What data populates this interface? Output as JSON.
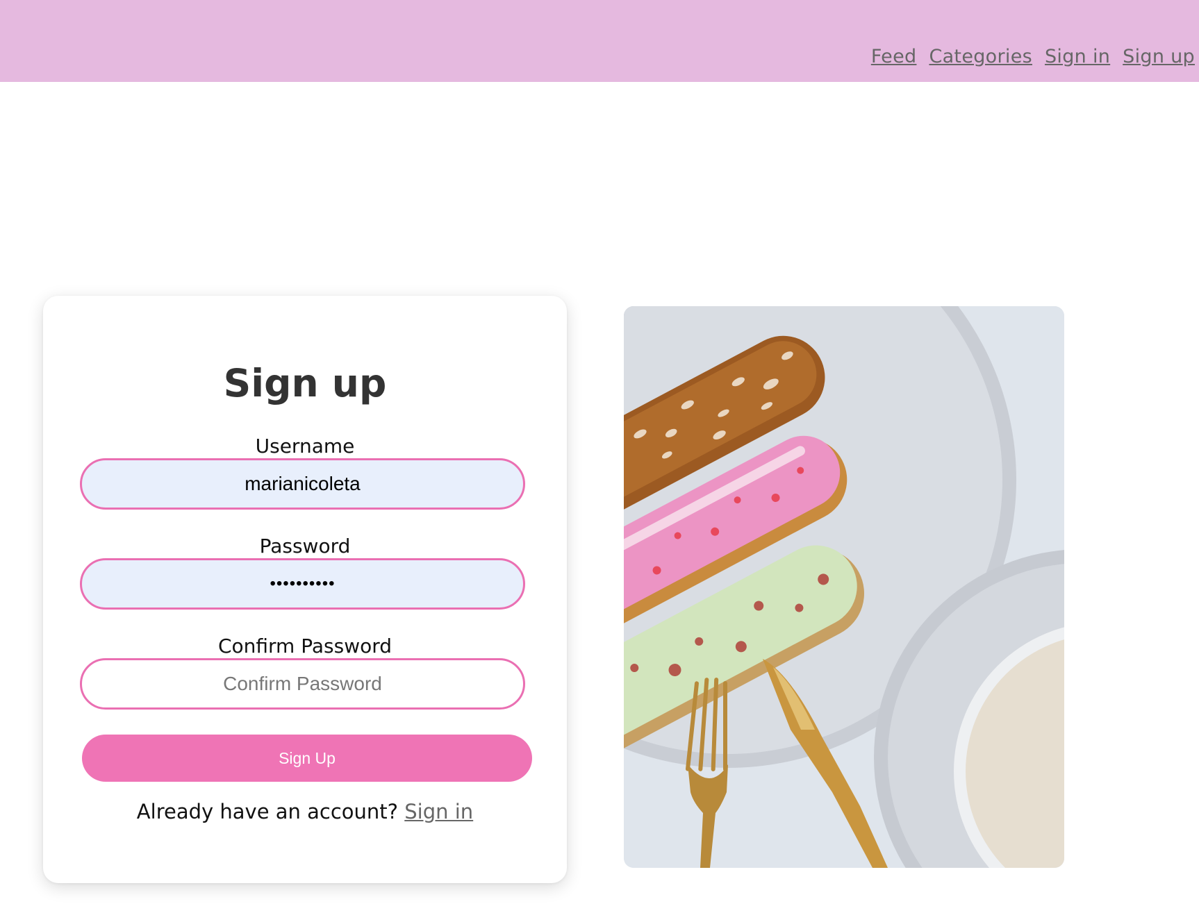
{
  "nav": {
    "links": [
      "Feed",
      "Categories",
      "Sign in",
      "Sign up"
    ]
  },
  "form": {
    "title": "Sign up",
    "username": {
      "label": "Username",
      "value": "marianicoleta"
    },
    "password": {
      "label": "Password",
      "value": "••••••••••"
    },
    "confirm": {
      "label": "Confirm Password",
      "value": "",
      "placeholder": "Confirm Password"
    },
    "submit_label": "Sign Up",
    "footer_text": "Already have an account?",
    "footer_link": "Sign in"
  },
  "colors": {
    "navbar_bg": "#e5b9df",
    "accent_pink": "#ef74b5",
    "input_border": "#ea6fb2",
    "filled_input_bg": "#e8effc"
  }
}
